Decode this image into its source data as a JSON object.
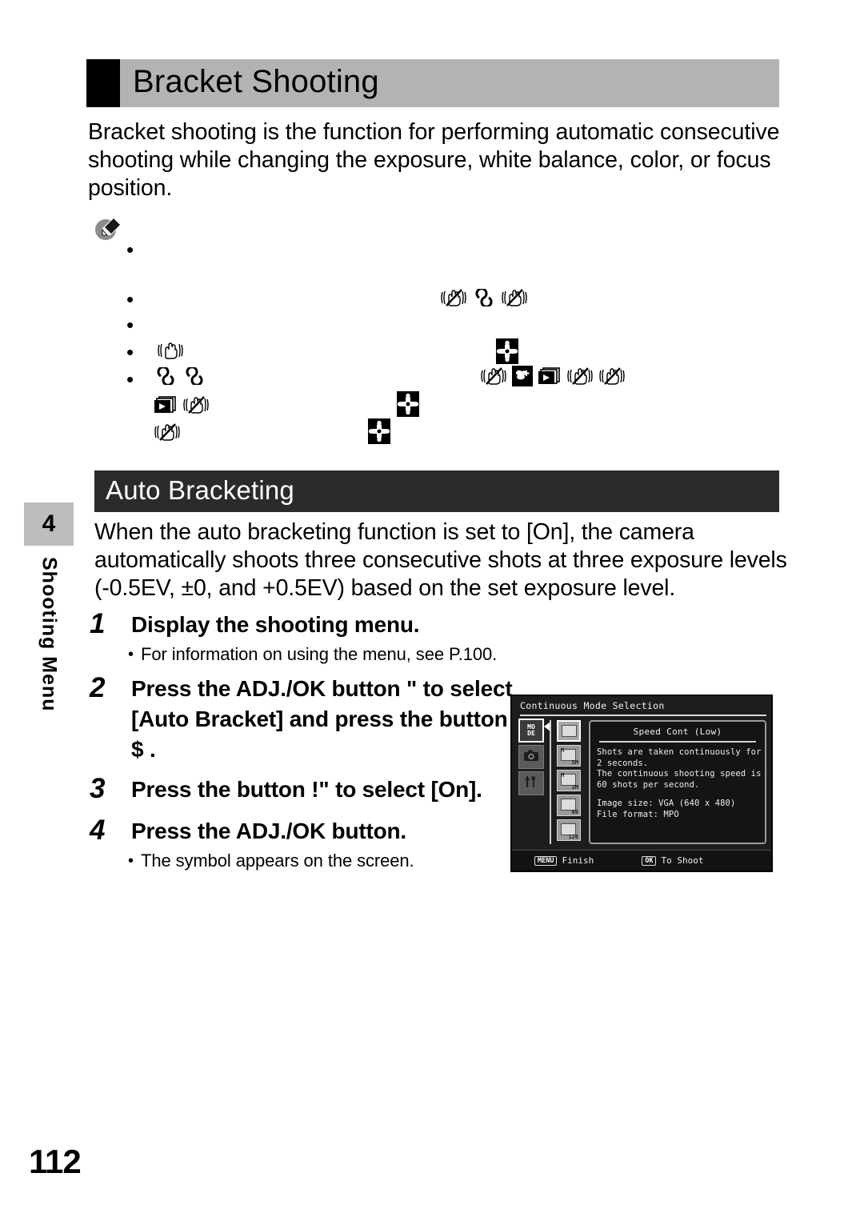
{
  "page": {
    "number": "112"
  },
  "chapter_tab": {
    "number": "4",
    "name": "Shooting Menu"
  },
  "header": {
    "title": "Bracket Shooting"
  },
  "intro": {
    "paragraph": "Bracket shooting is the function for performing automatic consecutive shooting while changing the exposure, white balance, color, or focus position."
  },
  "note": {
    "icon": "note-pencil-icon",
    "bullets": [
      {
        "text": "",
        "icons": []
      },
      {
        "text": "",
        "icons": [
          "hand-shake-off-icon",
          "infinity-icon",
          "hand-shake-off-icon"
        ]
      },
      {
        "text": "",
        "icons": []
      },
      {
        "text": "",
        "icons": [
          "hand-shake-icon",
          "four-way-pad-icon"
        ]
      },
      {
        "text": "",
        "icons": [
          "infinity-icon",
          "infinity-icon",
          "hand-shake-off-icon",
          "macro-flower-icon",
          "playback-stack-icon",
          "hand-shake-off-icon",
          "hand-shake-off-icon"
        ]
      },
      {
        "text": "",
        "icons": [
          "playback-stack-icon",
          "hand-shake-off-icon",
          "four-way-pad-icon"
        ]
      },
      {
        "text": "",
        "icons": [
          "hand-shake-off-icon",
          "four-way-pad-icon"
        ]
      }
    ]
  },
  "section": {
    "heading": "Auto Bracketing",
    "body": "When the auto bracketing function is set to [On], the camera automatically shoots three consecutive shots at three exposure levels (-0.5EV, ±0, and +0.5EV) based on the set exposure level."
  },
  "steps": [
    {
      "number": "1",
      "text": "Display the shooting menu.",
      "sub": "For information on using the menu, see P.100.",
      "bullet": "•"
    },
    {
      "number": "2",
      "text": "Press the ADJ./OK button \"  to select [Auto Bracket] and press the button $ .",
      "sub": "",
      "bullet": ""
    },
    {
      "number": "3",
      "text": "Press the button !\"   to select [On].",
      "sub": "",
      "bullet": ""
    },
    {
      "number": "4",
      "text": "Press the ADJ./OK button.",
      "sub": "The symbol appears on the screen.",
      "bullet": "•"
    }
  ],
  "lcd": {
    "title": "Continuous Mode Selection",
    "tabs": [
      {
        "name": "mode-tab",
        "label": "MO\nDE",
        "active": true
      },
      {
        "name": "camera-tab",
        "label": "",
        "active": false
      },
      {
        "name": "setup-tab",
        "label": "",
        "active": false
      }
    ],
    "mode_icons": [
      {
        "name": "cont-normal-icon",
        "tag": "",
        "tagm": "",
        "selected": true
      },
      {
        "name": "cont-5m-icon",
        "tag": "5M",
        "tagm": "M",
        "selected": false
      },
      {
        "name": "cont-2m-icon",
        "tag": "2M",
        "tagm": "M",
        "selected": false
      },
      {
        "name": "cont-60-icon",
        "tag": "60",
        "tagm": "",
        "selected": false
      },
      {
        "name": "cont-120-icon",
        "tag": "120",
        "tagm": "",
        "selected": false
      }
    ],
    "info": {
      "title": "Speed Cont (Low)",
      "body": "Shots are taken continuously for\n2 seconds.\nThe continuous shooting speed is\n60 shots per second.",
      "spec": "Image size: VGA (640 x 480)\nFile format: MPO"
    },
    "footer": {
      "left_key": "MENU",
      "left_label": "Finish",
      "right_key": "OK",
      "right_label": "To Shoot"
    }
  },
  "colors": {
    "title_bar": "#b3b3b3",
    "section_bar": "#2b2b2b",
    "chapter_tab": "#bdbdbd",
    "lcd_bg": "#1d1d1d"
  }
}
